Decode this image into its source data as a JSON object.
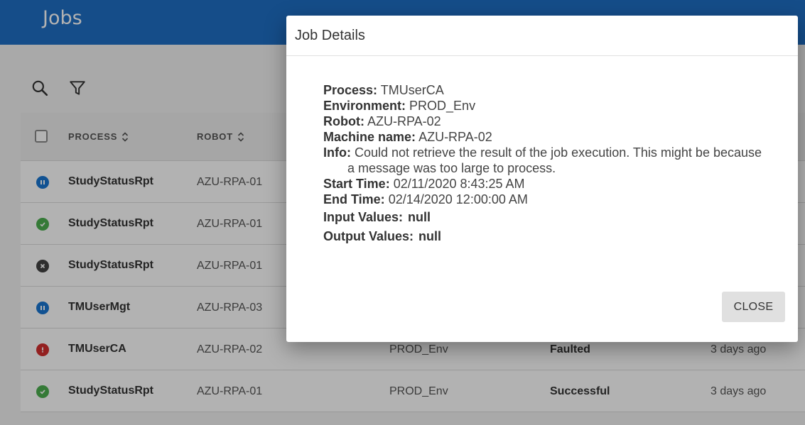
{
  "app": {
    "title": "Jobs"
  },
  "toolbar": {
    "search_icon": "search-icon",
    "filter_icon": "filter-icon"
  },
  "table": {
    "headers": {
      "process": "PROCESS",
      "robot": "ROBOT"
    },
    "rows": [
      {
        "status": "pending",
        "process": "StudyStatusRpt",
        "robot": "AZU-RPA-01",
        "environment": "",
        "state": "",
        "time": ""
      },
      {
        "status": "successful",
        "process": "StudyStatusRpt",
        "robot": "AZU-RPA-01",
        "environment": "",
        "state": "",
        "time": ""
      },
      {
        "status": "stopped",
        "process": "StudyStatusRpt",
        "robot": "AZU-RPA-01",
        "environment": "",
        "state": "",
        "time": ""
      },
      {
        "status": "pending",
        "process": "TMUserMgt",
        "robot": "AZU-RPA-03",
        "environment": "",
        "state": "",
        "time": ""
      },
      {
        "status": "faulted",
        "process": "TMUserCA",
        "robot": "AZU-RPA-02",
        "environment": "PROD_Env",
        "state": "Faulted",
        "time": "3 days ago"
      },
      {
        "status": "successful",
        "process": "StudyStatusRpt",
        "robot": "AZU-RPA-01",
        "environment": "PROD_Env",
        "state": "Successful",
        "time": "3 days ago"
      }
    ],
    "status_colors": {
      "pending": "#1976d2",
      "successful": "#4caf50",
      "stopped": "#424242",
      "faulted": "#d32f2f"
    }
  },
  "dialog": {
    "title": "Job Details",
    "process_label": "Process:",
    "process_value": "TMUserCA",
    "environment_label": "Environment:",
    "environment_value": "PROD_Env",
    "robot_label": "Robot:",
    "robot_value": "AZU-RPA-02",
    "machine_label": "Machine name:",
    "machine_value": "AZU-RPA-02",
    "info_label": "Info:",
    "info_value": "Could not retrieve the result of the job execution. This might be because a message was too large to process.",
    "start_label": "Start Time:",
    "start_value": "02/11/2020 8:43:25 AM",
    "end_label": "End Time:",
    "end_value": "02/14/2020 12:00:00 AM",
    "input_label": "Input Values:",
    "input_value": "null",
    "output_label": "Output Values:",
    "output_value": "null",
    "close_label": "CLOSE"
  },
  "colors": {
    "appbar": "#1f6fc5",
    "overlay": "rgba(0,0,0,0.30)"
  }
}
